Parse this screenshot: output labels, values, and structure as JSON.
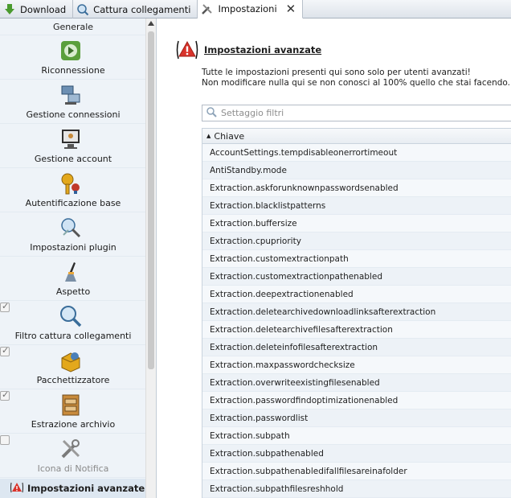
{
  "tabs": [
    {
      "label": "Download",
      "icon": "download-icon"
    },
    {
      "label": "Cattura collegamenti",
      "icon": "link-grabber-icon"
    },
    {
      "label": "Impostazioni",
      "icon": "settings-icon",
      "active": true
    }
  ],
  "sidebar": {
    "first": "Generale",
    "items": [
      {
        "label": "Riconnessione",
        "icon": "reconnect-icon"
      },
      {
        "label": "Gestione connessioni",
        "icon": "connection-manager-icon"
      },
      {
        "label": "Gestione account",
        "icon": "account-manager-icon"
      },
      {
        "label": "Autentificazione base",
        "icon": "basic-auth-icon"
      },
      {
        "label": "Impostazioni plugin",
        "icon": "plugin-settings-icon"
      },
      {
        "label": "Aspetto",
        "icon": "appearance-icon"
      },
      {
        "label": "Filtro cattura collegamenti",
        "icon": "link-filter-icon",
        "checkbox": true
      },
      {
        "label": "Pacchettizzatore",
        "icon": "packager-icon",
        "checkbox": true
      },
      {
        "label": "Estrazione archivio",
        "icon": "archive-extraction-icon",
        "checkbox": true
      },
      {
        "label": "Icona di Notifica",
        "icon": "tray-icon",
        "checkbox": false,
        "disabled": true
      }
    ],
    "selected": "Impostazioni avanzate"
  },
  "main": {
    "title": "Impostazioni avanzate",
    "desc_line1": "Tutte le impostazioni presenti qui sono solo per utenti avanzati!",
    "desc_line2": "Non modificare nulla qui se non conosci al 100% quello che stai facendo.",
    "filter_placeholder": "Settaggio filtri",
    "column_header": "Chiave",
    "rows": [
      "AccountSettings.tempdisableonerrortimeout",
      "AntiStandby.mode",
      "Extraction.askforunknownpasswordsenabled",
      "Extraction.blacklistpatterns",
      "Extraction.buffersize",
      "Extraction.cpupriority",
      "Extraction.customextractionpath",
      "Extraction.customextractionpathenabled",
      "Extraction.deepextractionenabled",
      "Extraction.deletearchivedownloadlinksafterextraction",
      "Extraction.deletearchivefilesafterextraction",
      "Extraction.deleteinfofilesafterextraction",
      "Extraction.maxpasswordchecksize",
      "Extraction.overwriteexistingfilesenabled",
      "Extraction.passwordfindoptimizationenabled",
      "Extraction.passwordlist",
      "Extraction.subpath",
      "Extraction.subpathenabled",
      "Extraction.subpathenabledifallfilesareinafolder",
      "Extraction.subpathfilesreshhold"
    ]
  }
}
